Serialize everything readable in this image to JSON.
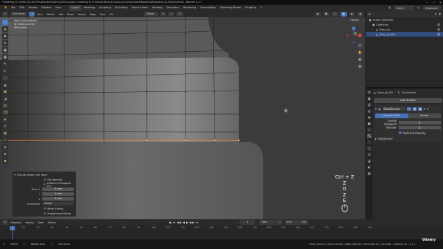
{
  "titlebar": {
    "text": "*Modeling_01_Model [D:\\3D\\The\\Selected\\Udemy\\2024\\product modeling fo in blender\\Beauty product\\Course\\Create\\Modeling\\Modeling_01_Model.blend] - Blender 4.1.1"
  },
  "menu": {
    "items": [
      "File",
      "Edit",
      "Render",
      "Window",
      "Help"
    ]
  },
  "workspaces": [
    "Layout",
    "Modeling",
    "Sculpting",
    "UV Editing",
    "Texture Paint",
    "Shading",
    "Animation",
    "Rendering",
    "Compositing",
    "Geometry Nodes",
    "Scripting"
  ],
  "scene": {
    "icon": "scene-icon",
    "name": "Scene",
    "view_layer": "ViewLayer"
  },
  "viewport": {
    "mode": "Edit Mode",
    "menus": [
      "View",
      "Select",
      "Add",
      "Mesh",
      "Vertex",
      "Edge",
      "Face",
      "UV"
    ],
    "orientation": "Global",
    "options_label": "Options",
    "info_lines": [
      "Front Orthographic",
      "(1) Glass_Jar.001",
      "Millimeters"
    ]
  },
  "key_overlay": {
    "lines": [
      "Ctrl + Z",
      "Z",
      "O",
      "Z",
      "E"
    ]
  },
  "operator_panel": {
    "title": "Extrude Region and Move",
    "flip_normals": "Flip Normals",
    "dissolve": "Dissolve Orthogonal Ed...",
    "move_x_label": "Move X",
    "move_x": "0 mm",
    "move_y_label": "Y",
    "move_y": "0 mm",
    "move_z_label": "Z",
    "move_z": "0 mm",
    "orientation_label": "Orientation",
    "orientation_value": "Global",
    "mirror_editing": "Mirror Editing",
    "proportional_editing": "Proportional Editing"
  },
  "outliner": {
    "header": "Scene Collection",
    "rows": [
      {
        "label": "Scene Collection",
        "indent": 0,
        "selected": false
      },
      {
        "label": "Collection",
        "indent": 1,
        "selected": false
      },
      {
        "label": "Glass_Jar",
        "indent": 2,
        "selected": false
      },
      {
        "label": "Glass_Jar.001",
        "indent": 2,
        "selected": true
      }
    ]
  },
  "properties": {
    "object_name": "Glass_Jar.001",
    "modifier_type": "Subdivision",
    "add_modifier": "Add Modifier",
    "modifier_name": "Subdivision",
    "catmull_clark": "Catmull-Clark",
    "simple": "Simple",
    "levels_viewport_label": "Levels Viewport",
    "levels_viewport": "1",
    "render_label": "Render",
    "render": "2",
    "optimal_display": "Optimal Display",
    "advanced": "Advanced"
  },
  "timeline": {
    "menus": [
      "Playback",
      "Keying",
      "View",
      "Marker"
    ],
    "current_frame": "1",
    "start_label": "Start",
    "start": "1",
    "end_label": "End",
    "end": "250",
    "ticks": [
      "10",
      "20",
      "30",
      "40",
      "50",
      "60",
      "70",
      "80",
      "90",
      "100",
      "110",
      "120",
      "130",
      "140",
      "150",
      "160",
      "170",
      "180",
      "190",
      "200",
      "210",
      "220",
      "230",
      "240",
      "250"
    ]
  },
  "statusbar": {
    "left1": "Select",
    "left2": "Rotate View",
    "left3": "Call Menu",
    "stats": "Glass_Jar.001 | Verts 0/2152 | Edges 0/4232 | Faces 0/2112 | Tris 4184 | Objects 1/2 | 4.1.1",
    "brand": "Udemy"
  }
}
